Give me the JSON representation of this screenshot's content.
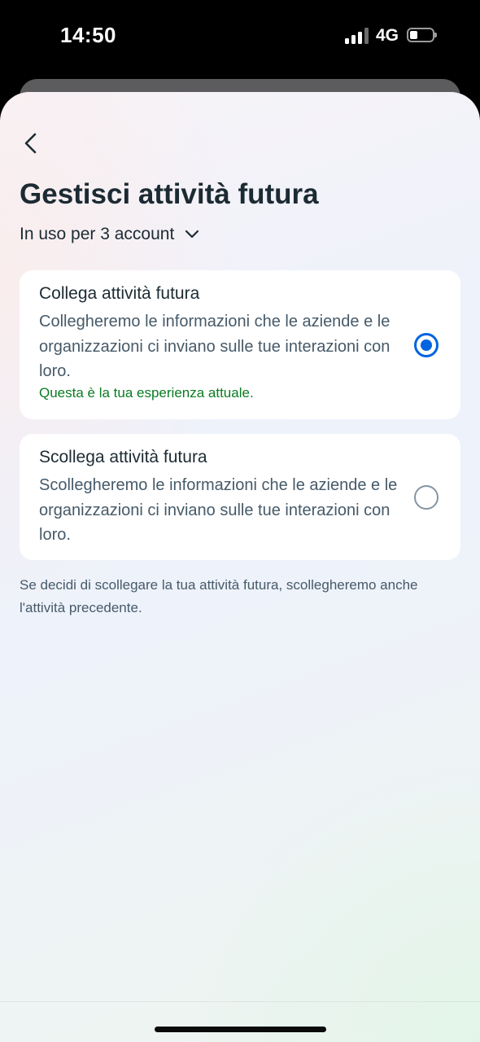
{
  "status_bar": {
    "time": "14:50",
    "network": "4G",
    "signal_bars_filled": 3,
    "signal_bars_total": 4,
    "battery_level_percent": 20
  },
  "header": {
    "back_icon": "chevron-left-icon",
    "title": "Gestisci attività futura"
  },
  "account_selector": {
    "label": "In uso per 3 account",
    "icon": "chevron-down-icon"
  },
  "options": [
    {
      "title": "Collega attività futura",
      "description": "Collegheremo le informazioni che le aziende e le organizzazioni ci inviano sulle tue interazioni con loro.",
      "status": "Questa è la tua esperienza attuale.",
      "selected": true
    },
    {
      "title": "Scollega attività futura",
      "description": "Scollegheremo le informazioni che le aziende e le organizzazioni ci inviano sulle tue interazioni con loro.",
      "selected": false
    }
  ],
  "footnote": "Se decidi di scollegare la tua attività futura, scollegheremo anche l'attività precedente.",
  "colors": {
    "accent": "#0064e0",
    "status_text": "#0a7c22",
    "primary_text": "#1c2b33",
    "secondary_text": "#465a69"
  }
}
